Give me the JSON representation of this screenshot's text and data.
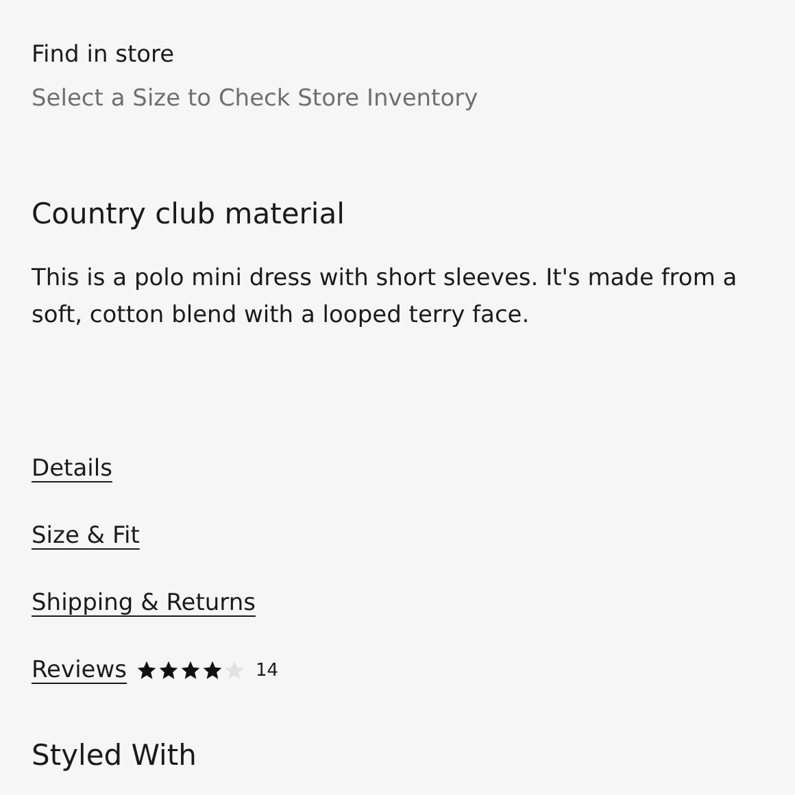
{
  "find_in_store": {
    "title": "Find in store",
    "hint": "Select a Size to Check Store Inventory"
  },
  "section": {
    "heading": "Country club material",
    "description": "This is a polo mini dress with short sleeves. It's made from a soft, cotton blend with a looped terry face."
  },
  "links": [
    {
      "label": "Details"
    },
    {
      "label": "Size & Fit"
    },
    {
      "label": "Shipping & Returns"
    }
  ],
  "reviews": {
    "label": "Reviews",
    "stars": 4,
    "count": "14"
  },
  "next_section": {
    "heading": "Styled With"
  }
}
